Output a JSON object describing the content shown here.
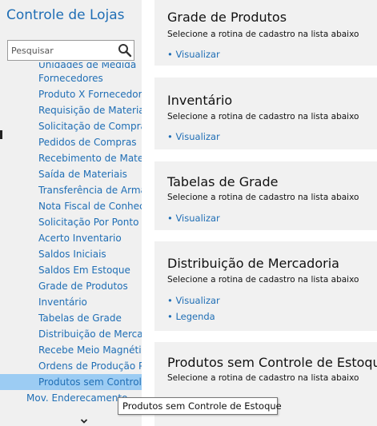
{
  "sidebar": {
    "title": "Controle de Lojas",
    "search": {
      "placeholder": "Pesquisar",
      "value": ""
    },
    "items": [
      {
        "label": "Unidades de Medida"
      },
      {
        "label": "Fornecedores"
      },
      {
        "label": "Produto X Fornecedor"
      },
      {
        "label": "Requisição de Materiais"
      },
      {
        "label": "Solicitação de Compras"
      },
      {
        "label": "Pedidos de Compras"
      },
      {
        "label": "Recebimento de Materiais"
      },
      {
        "label": "Saída de Materiais"
      },
      {
        "label": "Transferência de Armazém"
      },
      {
        "label": "Nota Fiscal de Conhecimento"
      },
      {
        "label": "Solicitação Por Ponto de Pedido"
      },
      {
        "label": "Acerto Inventario"
      },
      {
        "label": "Saldos Iniciais"
      },
      {
        "label": "Saldos Em Estoque"
      },
      {
        "label": "Grade de Produtos"
      },
      {
        "label": "Inventário"
      },
      {
        "label": "Tabelas de Grade"
      },
      {
        "label": "Distribuição de Mercadoria"
      },
      {
        "label": "Recebe Meio Magnético"
      },
      {
        "label": "Ordens de Produção Por Grade"
      },
      {
        "label": "Produtos sem Controle de Estoque"
      }
    ],
    "footer_item": "Mov. Enderecamento"
  },
  "cards": [
    {
      "title": "Grade de Produtos",
      "subtitle": "Selecione a rotina de cadastro na lista abaixo",
      "links": [
        "• Visualizar"
      ]
    },
    {
      "title": "Inventário",
      "subtitle": "Selecione a rotina de cadastro na lista abaixo",
      "links": [
        "• Visualizar"
      ]
    },
    {
      "title": "Tabelas de Grade",
      "subtitle": "Selecione a rotina de cadastro na lista abaixo",
      "links": [
        "• Visualizar"
      ]
    },
    {
      "title": "Distribuição de Mercadoria",
      "subtitle": "Selecione a rotina de cadastro na lista abaixo",
      "links": [
        "• Visualizar",
        "• Legenda"
      ]
    },
    {
      "title": "Produtos sem Controle de Estoque",
      "subtitle": "Selecione a rotina de cadastro na lista abaixo",
      "links": []
    }
  ],
  "tooltip": "Produtos sem Controle de Estoque",
  "colors": {
    "link": "#1f6eb5",
    "selected": "#9cccf3",
    "panel": "#f0f0f0"
  }
}
